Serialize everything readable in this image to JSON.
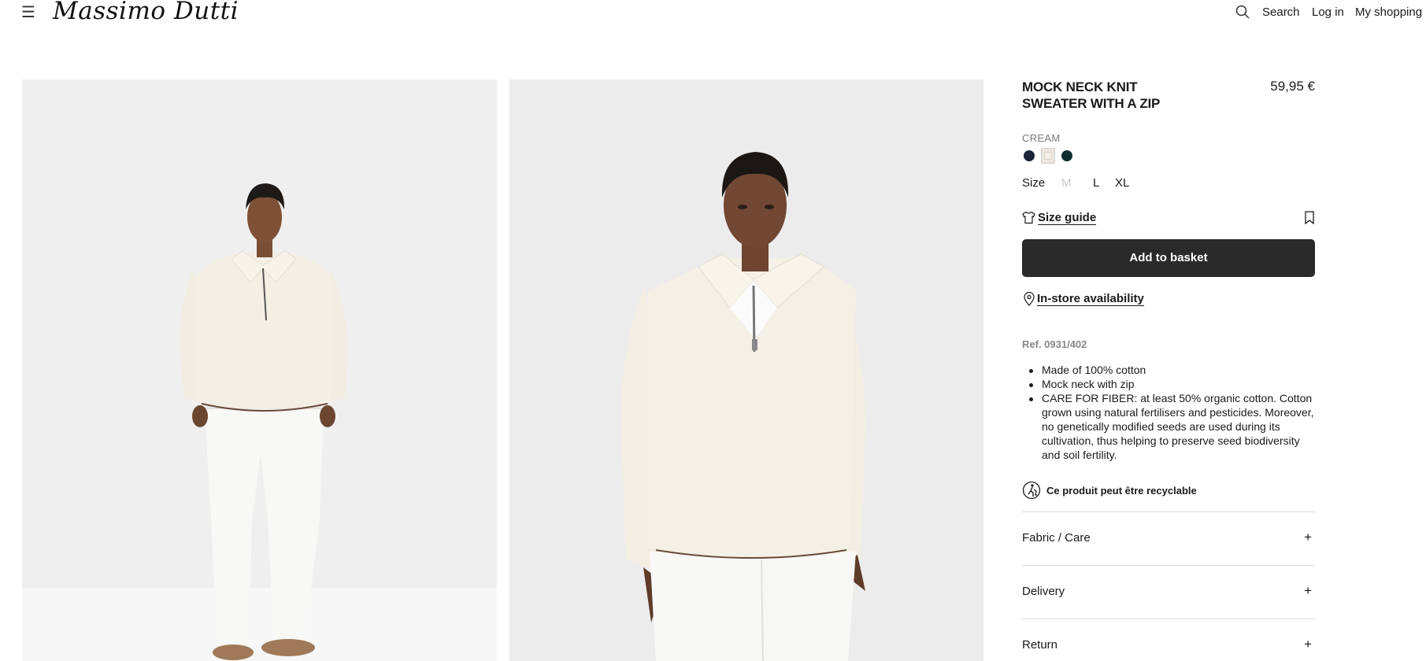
{
  "header": {
    "brand": "Massimo Dutti",
    "menu_icon": "☰",
    "search_label": "Search",
    "login_label": "Log in",
    "basket_label": "My shopping b"
  },
  "product": {
    "title": "MOCK NECK KNIT SWEATER WITH A ZIP",
    "price": "59,95 €",
    "color_name": "CREAM",
    "swatch_colors": [
      "#1c2438",
      "#f4efe6",
      "#0f2d2f"
    ],
    "size_label": "Size",
    "sizes": [
      {
        "label": "M",
        "available": false
      },
      {
        "label": "L",
        "available": true
      },
      {
        "label": "XL",
        "available": true
      }
    ],
    "size_guide_label": "Size guide",
    "add_to_basket_label": "Add to basket",
    "in_store_label": "In-store availability",
    "reference": "Ref. 0931/402",
    "features": [
      "Made of 100% cotton",
      "Mock neck with zip",
      "CARE FOR FIBER: at least 50% organic cotton. Cotton grown using natural fertilisers and pesticides. Moreover, no genetically modified seeds are used during its cultivation, thus helping to preserve seed biodiversity and soil fertility."
    ],
    "recyclable_label": "Ce produit peut être recyclable",
    "accordions": [
      {
        "label": "Fabric / Care",
        "icon": "+"
      },
      {
        "label": "Delivery",
        "icon": "+"
      },
      {
        "label": "Return",
        "icon": "+"
      }
    ]
  },
  "colors": {
    "button_bg": "#2a2a2a",
    "button_text": "#ffffff",
    "muted_text": "#777777",
    "photo_bg": "#f0f0f0"
  }
}
